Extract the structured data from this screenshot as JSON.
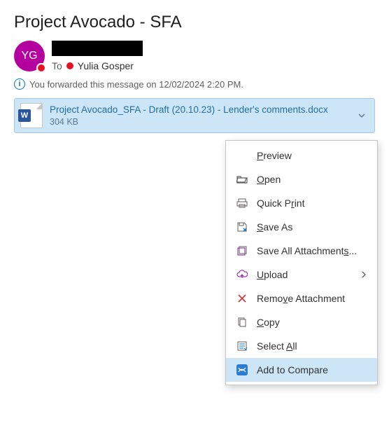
{
  "subject": "Project Avocado - SFA",
  "avatar": {
    "initials": "YG",
    "presence": "busy"
  },
  "to_label": "To",
  "recipient": "Yulia Gosper",
  "info_text": "You forwarded this message on 12/02/2024 2:20 PM.",
  "attachment": {
    "filename": "Project Avocado_SFA - Draft (20.10.23) - Lender's comments.docx",
    "size": "304 KB",
    "badge": "W"
  },
  "menu": {
    "preview": "Preview",
    "open": "Open",
    "quick_print": "Quick Print",
    "save_as": "Save As",
    "save_all": "Save All Attachments...",
    "upload": "Upload",
    "remove": "Remove Attachment",
    "copy": "Copy",
    "select_all": "Select All",
    "add_compare": "Add to Compare"
  }
}
